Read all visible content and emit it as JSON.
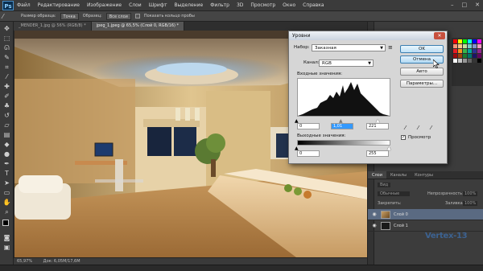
{
  "app": {
    "logo": "Ps",
    "menu": [
      "Файл",
      "Редактирование",
      "Изображение",
      "Слои",
      "Шрифт",
      "Выделение",
      "Фильтр",
      "3D",
      "Просмотр",
      "Окно",
      "Справка"
    ],
    "window_controls": [
      "–",
      "□",
      "✕"
    ]
  },
  "options_bar": {
    "sample_size_label": "Размер образца:",
    "sample_size_value": "Точка",
    "sample_label": "Образец:",
    "sample_value": "Все слои",
    "show_ring_label": "Показать кольцо пробы"
  },
  "tabs": [
    {
      "label": "_MENDER_1.jpg @ 56% (RGB/8) *"
    },
    {
      "label": "jpeg_1.jpeg @ 65,5% (Слой 0, RGB/16) *"
    }
  ],
  "status": {
    "zoom": "65,97%",
    "doc": "Док: 6,05М/17,6М"
  },
  "dialog": {
    "title": "Уровни",
    "close": "✕",
    "preset_label": "Набор:",
    "preset_value": "Заказная",
    "channel_label": "Канал:",
    "channel_value": "RGB",
    "input_label": "Входные значения:",
    "input_values": [
      "0",
      "1,01",
      "221"
    ],
    "output_label": "Выходные значения:",
    "output_values": [
      "0",
      "255"
    ],
    "buttons": {
      "ok": "OK",
      "cancel": "Отмена",
      "auto": "Авто",
      "options": "Параметры..."
    },
    "preview_label": "Просмотр",
    "preview_checked": "✓"
  },
  "layers_panel": {
    "tabs": [
      "Слои",
      "Каналы",
      "Контуры"
    ],
    "kind_label": "Вид",
    "blend_mode": "Обычные",
    "opacity_label": "Непрозрачность:",
    "opacity_value": "100%",
    "lock_label": "Закрепить:",
    "fill_label": "Заливка:",
    "fill_value": "100%",
    "layers": [
      {
        "name": "Слой 0",
        "selected": true
      },
      {
        "name": "Слой 1",
        "selected": false
      }
    ]
  },
  "watermark": "Vertex-13",
  "colors": {
    "accent": "#3399ff",
    "bg": "#282828",
    "dialog": "#d6d6d6"
  }
}
